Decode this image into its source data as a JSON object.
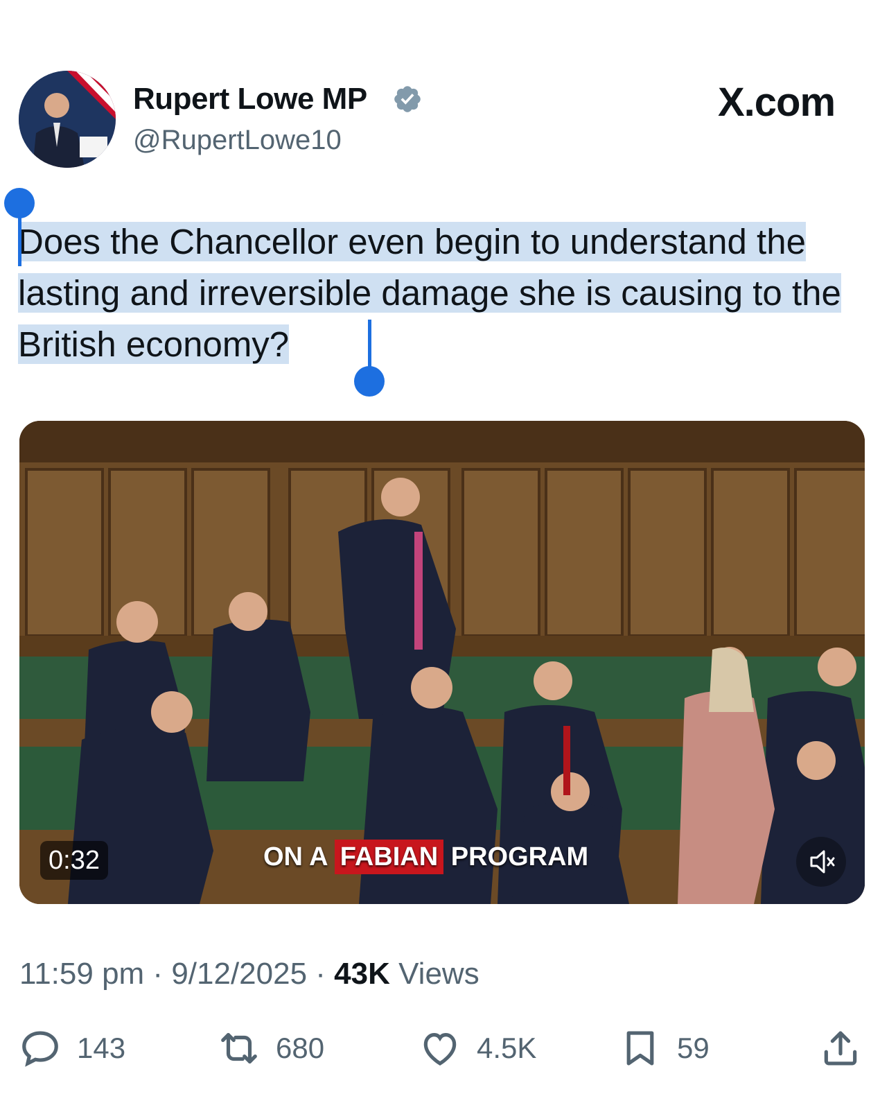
{
  "tweet": {
    "author_name": "Rupert Lowe MP",
    "handle": "@RupertLowe10",
    "brand": "X.com",
    "text": "Does the Chancellor even begin to understand the lasting and irreversible damage she is causing to the British economy?",
    "video": {
      "duration": "0:32",
      "caption_part1": "ON A",
      "caption_highlight": "FABIAN",
      "caption_part2": "PROGRAM"
    },
    "time": "11:59 pm",
    "date": "9/12/2025",
    "views_count": "43K",
    "views_label": "Views",
    "stats": {
      "replies": "143",
      "reposts": "680",
      "likes": "4.5K",
      "bookmarks": "59"
    }
  },
  "colors": {
    "text_primary": "#0f1419",
    "text_secondary": "#536471",
    "verified_blue": "#1d9bf0",
    "selection": "#cfe0f2",
    "selection_handle": "#1d6fe0",
    "caption_highlight": "#c8161d"
  },
  "icons": {
    "verified": "verified-badge-icon",
    "reply": "reply-icon",
    "repost": "repost-icon",
    "like": "heart-icon",
    "bookmark": "bookmark-icon",
    "share": "share-icon",
    "mute": "speaker-muted-icon"
  }
}
